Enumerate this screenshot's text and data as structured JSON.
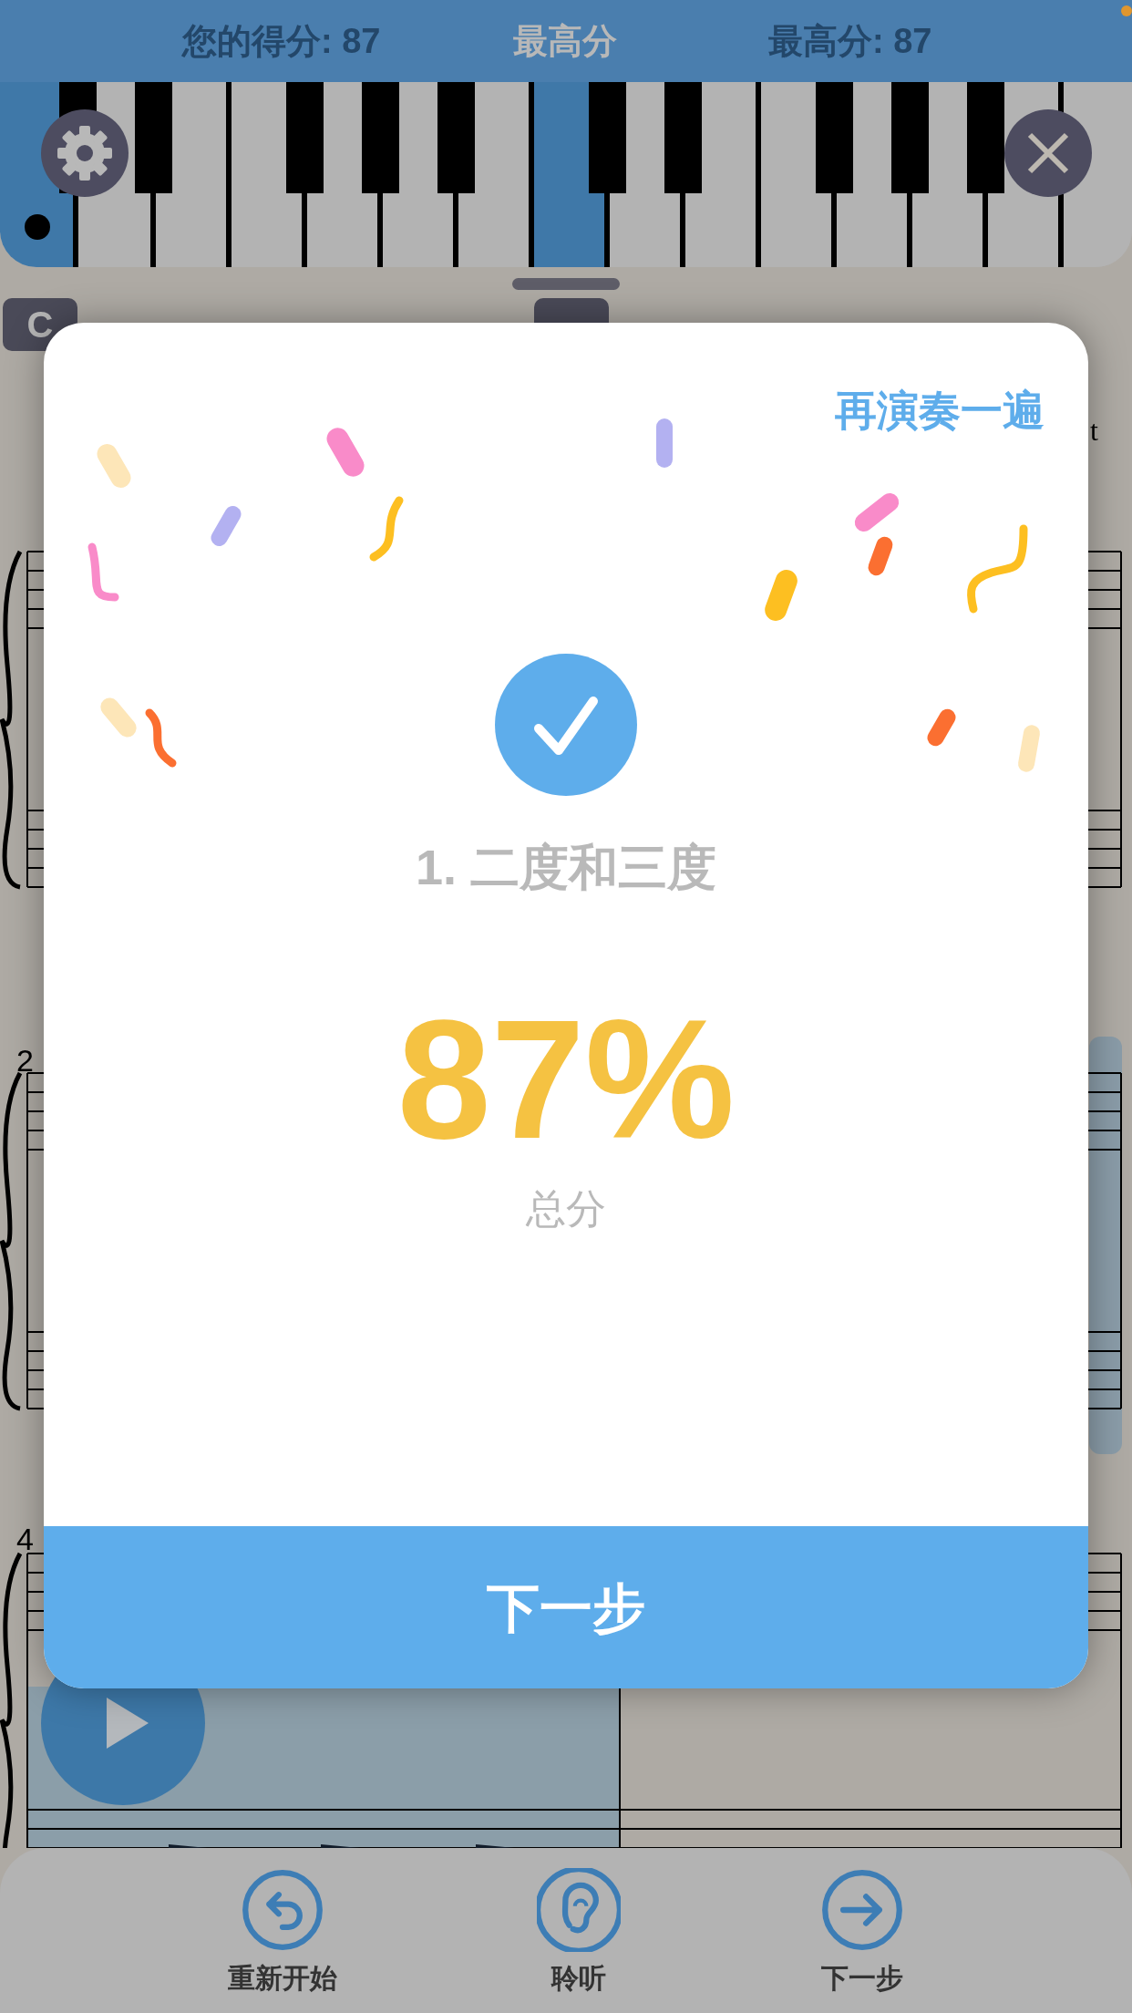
{
  "top_bar": {
    "your_score": "您的得分: 87",
    "title": "最高分",
    "best_score": "最高分: 87"
  },
  "piano": {
    "keys": [
      {
        "selected": false
      },
      {
        "selected": false
      },
      {
        "selected": false
      },
      {
        "selected": false
      },
      {
        "selected": false
      },
      {
        "selected": false
      },
      {
        "selected": true
      },
      {
        "selected": false
      },
      {
        "selected": false
      },
      {
        "selected": false
      },
      {
        "selected": false
      },
      {
        "selected": false
      },
      {
        "selected": false
      },
      {
        "selected": false
      }
    ]
  },
  "sheet": {
    "key_labels": [
      "C"
    ],
    "right_fragment": "t",
    "measure_numbers": [
      "2",
      "4"
    ]
  },
  "dialog": {
    "replay": "再演奏一遍",
    "lesson": "1. 二度和三度",
    "score": "87%",
    "score_label": "总分",
    "next_button": "下一步"
  },
  "bottom_bar": [
    {
      "kind": "restart",
      "label": "重新开始"
    },
    {
      "kind": "listen",
      "label": "聆听"
    },
    {
      "kind": "next",
      "label": "下一步"
    }
  ]
}
